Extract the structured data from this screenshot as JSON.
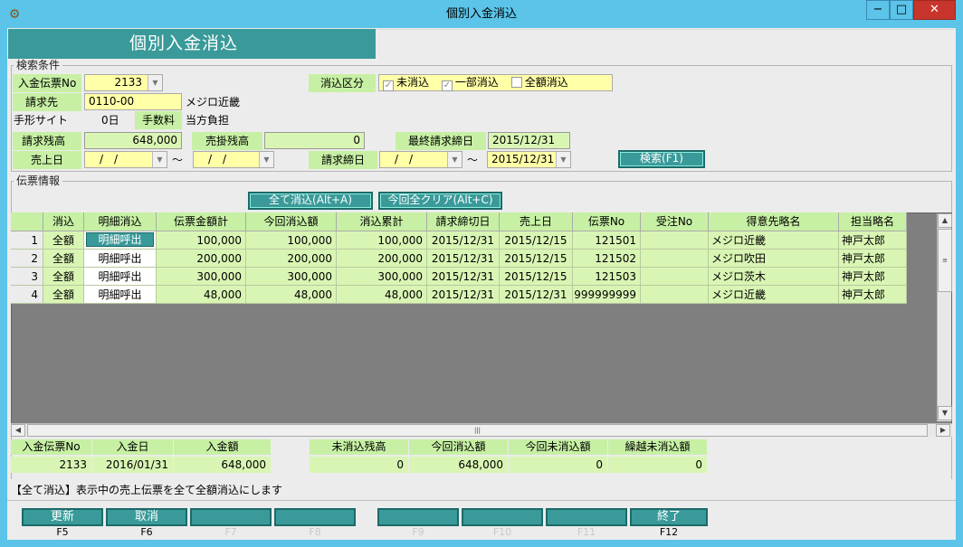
{
  "window": {
    "title": "個別入金消込",
    "minimize_glyph": "−",
    "maximize_glyph": "□",
    "close_glyph": "✕"
  },
  "banner": {
    "title": "個別入金消込"
  },
  "search": {
    "group_label": "検索条件",
    "deposit_no_label": "入金伝票No",
    "deposit_no_value": "2133",
    "billing_label": "請求先",
    "billing_code": "0110-00",
    "billing_name": "メジロ近畿",
    "bill_site_label": "手形サイト",
    "bill_site_value": "0日",
    "fee_label": "手数料",
    "fee_value": "当方負担",
    "billing_balance_label": "請求残高",
    "billing_balance_value": "648,000",
    "receivable_label": "売掛残高",
    "receivable_value": "0",
    "last_billing_label": "最終請求締日",
    "last_billing_value": "2015/12/31",
    "sales_date_label": "売上日",
    "sales_date_from": "　/　/",
    "sales_date_to": "　/　/",
    "tilde": "～",
    "billing_close_label": "請求締日",
    "billing_close_from": "　/　/",
    "billing_close_to": "2015/12/31",
    "clearing_type_label": "消込区分",
    "chk_uncleared": "未消込",
    "chk_partial": "一部消込",
    "chk_full": "全額消込",
    "search_button": "検索(F1)"
  },
  "slip": {
    "group_label": "伝票情報",
    "clear_all_button": "全て消込(Alt+A)",
    "reset_button": "今回全クリア(Alt+C)"
  },
  "grid": {
    "headers": [
      "消込",
      "明細消込",
      "伝票金額計",
      "今回消込額",
      "消込累計",
      "請求締切日",
      "売上日",
      "伝票No",
      "受注No",
      "得意先略名",
      "担当略名"
    ],
    "rows": [
      {
        "no": "1",
        "clear": "全額",
        "detail": "明細呼出",
        "amount": "100,000",
        "this_clear": "100,000",
        "cumulative": "100,000",
        "close_date": "2015/12/31",
        "sales_date": "2015/12/15",
        "slip_no": "121501",
        "order_no": "",
        "customer": "メジロ近畿",
        "staff": "神戸太郎"
      },
      {
        "no": "2",
        "clear": "全額",
        "detail": "明細呼出",
        "amount": "200,000",
        "this_clear": "200,000",
        "cumulative": "200,000",
        "close_date": "2015/12/31",
        "sales_date": "2015/12/15",
        "slip_no": "121502",
        "order_no": "",
        "customer": "メジロ吹田",
        "staff": "神戸太郎"
      },
      {
        "no": "3",
        "clear": "全額",
        "detail": "明細呼出",
        "amount": "300,000",
        "this_clear": "300,000",
        "cumulative": "300,000",
        "close_date": "2015/12/31",
        "sales_date": "2015/12/15",
        "slip_no": "121503",
        "order_no": "",
        "customer": "メジロ茨木",
        "staff": "神戸太郎"
      },
      {
        "no": "4",
        "clear": "全額",
        "detail": "明細呼出",
        "amount": "48,000",
        "this_clear": "48,000",
        "cumulative": "48,000",
        "close_date": "2015/12/31",
        "sales_date": "2015/12/31",
        "slip_no": "999999999",
        "order_no": "",
        "customer": "メジロ近畿",
        "staff": "神戸太郎"
      }
    ]
  },
  "summary": {
    "deposit_no_label": "入金伝票No",
    "deposit_no": "2133",
    "deposit_date_label": "入金日",
    "deposit_date": "2016/01/31",
    "deposit_amount_label": "入金額",
    "deposit_amount": "648,000",
    "uncleared_label": "未消込残高",
    "uncleared": "0",
    "this_clear_label": "今回消込額",
    "this_clear": "648,000",
    "this_uncleared_label": "今回未消込額",
    "this_uncleared": "0",
    "carried_label": "繰越未消込額",
    "carried": "0"
  },
  "message": "【全て消込】表示中の売上伝票を全て全額消込にします",
  "fkeys": [
    {
      "label": "更新",
      "key": "F5"
    },
    {
      "label": "取消",
      "key": "F6"
    },
    {
      "label": "",
      "key": "F7"
    },
    {
      "label": "",
      "key": "F8"
    },
    {
      "label": "",
      "key": "F9"
    },
    {
      "label": "",
      "key": "F10"
    },
    {
      "label": "",
      "key": "F11"
    },
    {
      "label": "終了",
      "key": "F12"
    }
  ],
  "colors": {
    "accent": "#3a9a9a",
    "label_bg": "#c7f0a4",
    "row_bg": "#d9f5b4",
    "titlebar": "#5bc4e8"
  }
}
